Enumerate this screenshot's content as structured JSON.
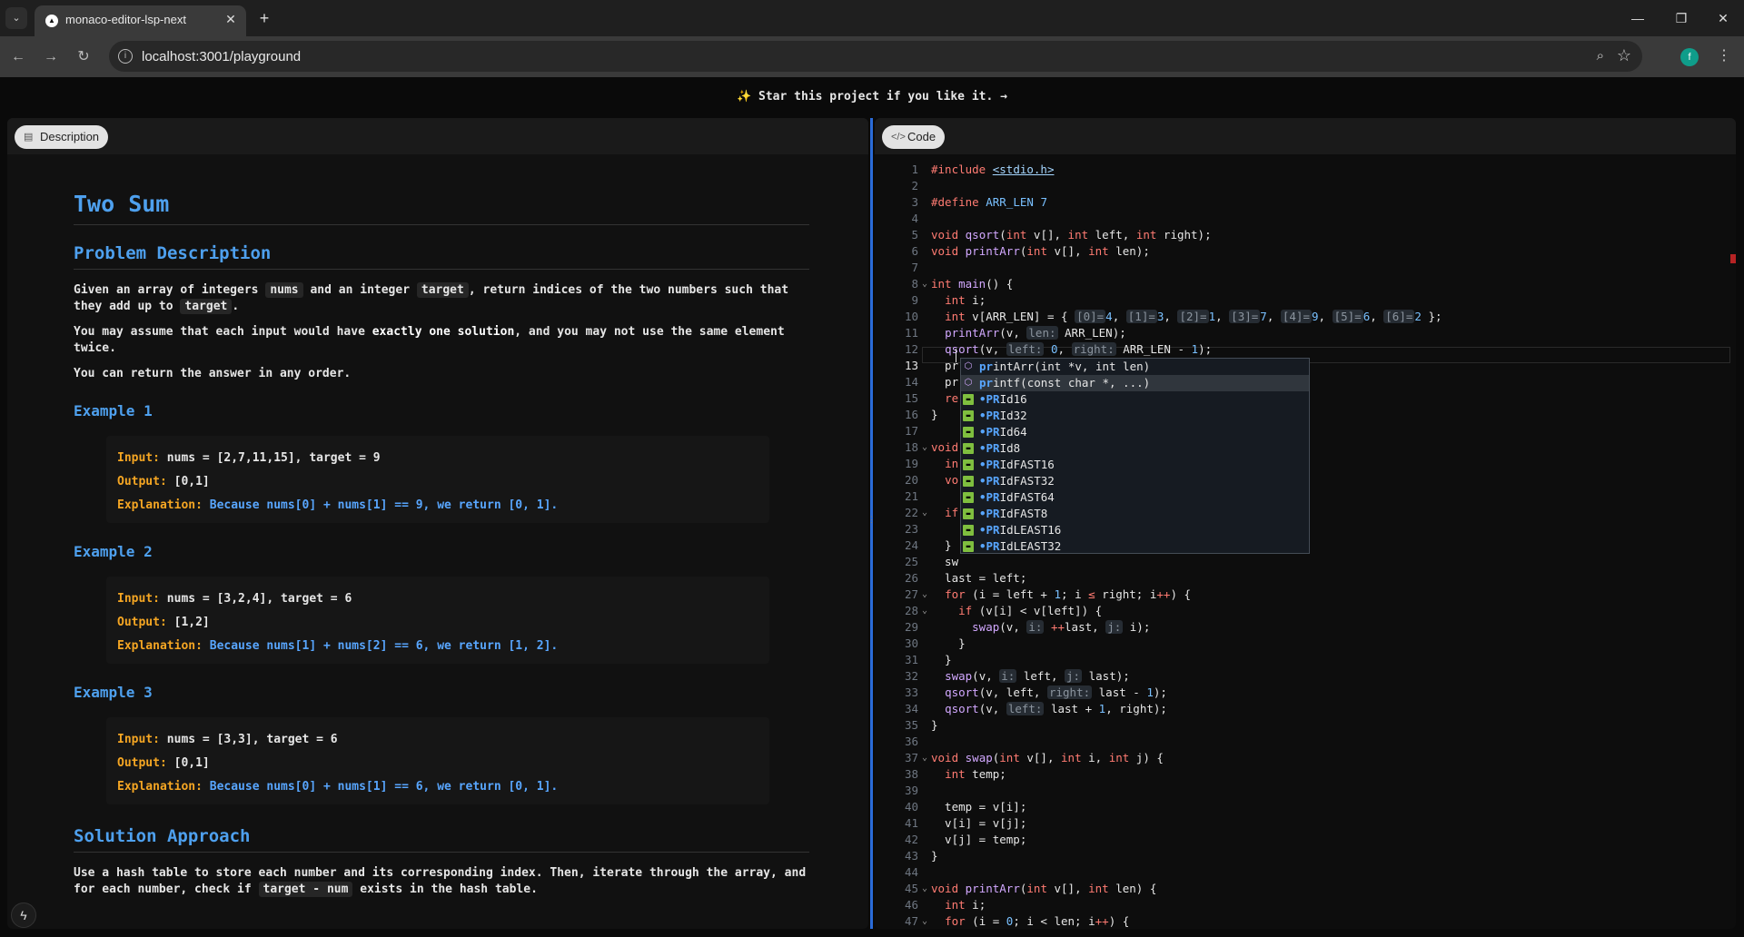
{
  "browser": {
    "tab_title": "monaco-editor-lsp-next",
    "url": "localhost:3001/playground",
    "avatar_letter": "f"
  },
  "banner": "✨ Star this project if you like it. →",
  "left_panel": {
    "chip": "Description",
    "title": "Two Sum",
    "problem_heading": "Problem Description",
    "p1_a": "Given an array of integers",
    "p1_code1": "nums",
    "p1_b": "and an integer",
    "p1_code2": "target",
    "p1_c": ", return indices of the two numbers such that they add up to",
    "p1_code3": "target",
    "p1_d": ".",
    "p2_a": "You may assume that each input would have",
    "p2_strong": "exactly one solution",
    "p2_b": ", and you may not use the same element twice.",
    "p3": "You can return the answer in any order.",
    "examples": [
      {
        "heading": "Example 1",
        "input_label": "Input:",
        "input": " nums = [2,7,11,15], target = 9",
        "output_label": "Output:",
        "output": " [0,1]",
        "exp_label": "Explanation:",
        "exp": " Because nums[0] + nums[1] == 9, we return [0, 1]."
      },
      {
        "heading": "Example 2",
        "input_label": "Input:",
        "input": " nums = [3,2,4], target = 6",
        "output_label": "Output:",
        "output": " [1,2]",
        "exp_label": "Explanation:",
        "exp": " Because nums[1] + nums[2] == 6, we return [1, 2]."
      },
      {
        "heading": "Example 3",
        "input_label": "Input:",
        "input": " nums = [3,3], target = 6",
        "output_label": "Output:",
        "output": " [0,1]",
        "exp_label": "Explanation:",
        "exp": " Because nums[0] + nums[1] == 6, we return [0, 1]."
      }
    ],
    "solution_heading": "Solution Approach",
    "sol_a": "Use a hash table to store each number and its corresponding index. Then, iterate through the array, and for each number, check if",
    "sol_code": "target - num",
    "sol_b": "exists in the hash table."
  },
  "right_panel": {
    "chip": "Code",
    "lines": [
      "1",
      "2",
      "3",
      "4",
      "5",
      "6",
      "7",
      "8",
      "9",
      "10",
      "11",
      "12",
      "13",
      "14",
      "15",
      "16",
      "17",
      "18",
      "19",
      "20",
      "21",
      "22",
      "23",
      "24",
      "25",
      "26",
      "27",
      "28",
      "29",
      "30",
      "31",
      "32",
      "33",
      "34",
      "35",
      "36",
      "37",
      "38",
      "39",
      "40",
      "41",
      "42",
      "43",
      "44",
      "45",
      "46",
      "47"
    ],
    "suggestions": [
      {
        "match": "pr",
        "rest": "intArr(int *v, int len)"
      },
      {
        "match": "pr",
        "rest": "intf(const char *, ...)"
      },
      {
        "match": "•PR",
        "rest": "Id16"
      },
      {
        "match": "•PR",
        "rest": "Id32"
      },
      {
        "match": "•PR",
        "rest": "Id64"
      },
      {
        "match": "•PR",
        "rest": "Id8"
      },
      {
        "match": "•PR",
        "rest": "IdFAST16"
      },
      {
        "match": "•PR",
        "rest": "IdFAST32"
      },
      {
        "match": "•PR",
        "rest": "IdFAST64"
      },
      {
        "match": "•PR",
        "rest": "IdFAST8"
      },
      {
        "match": "•PR",
        "rest": "IdLEAST16"
      },
      {
        "match": "•PR",
        "rest": "IdLEAST32"
      }
    ]
  }
}
